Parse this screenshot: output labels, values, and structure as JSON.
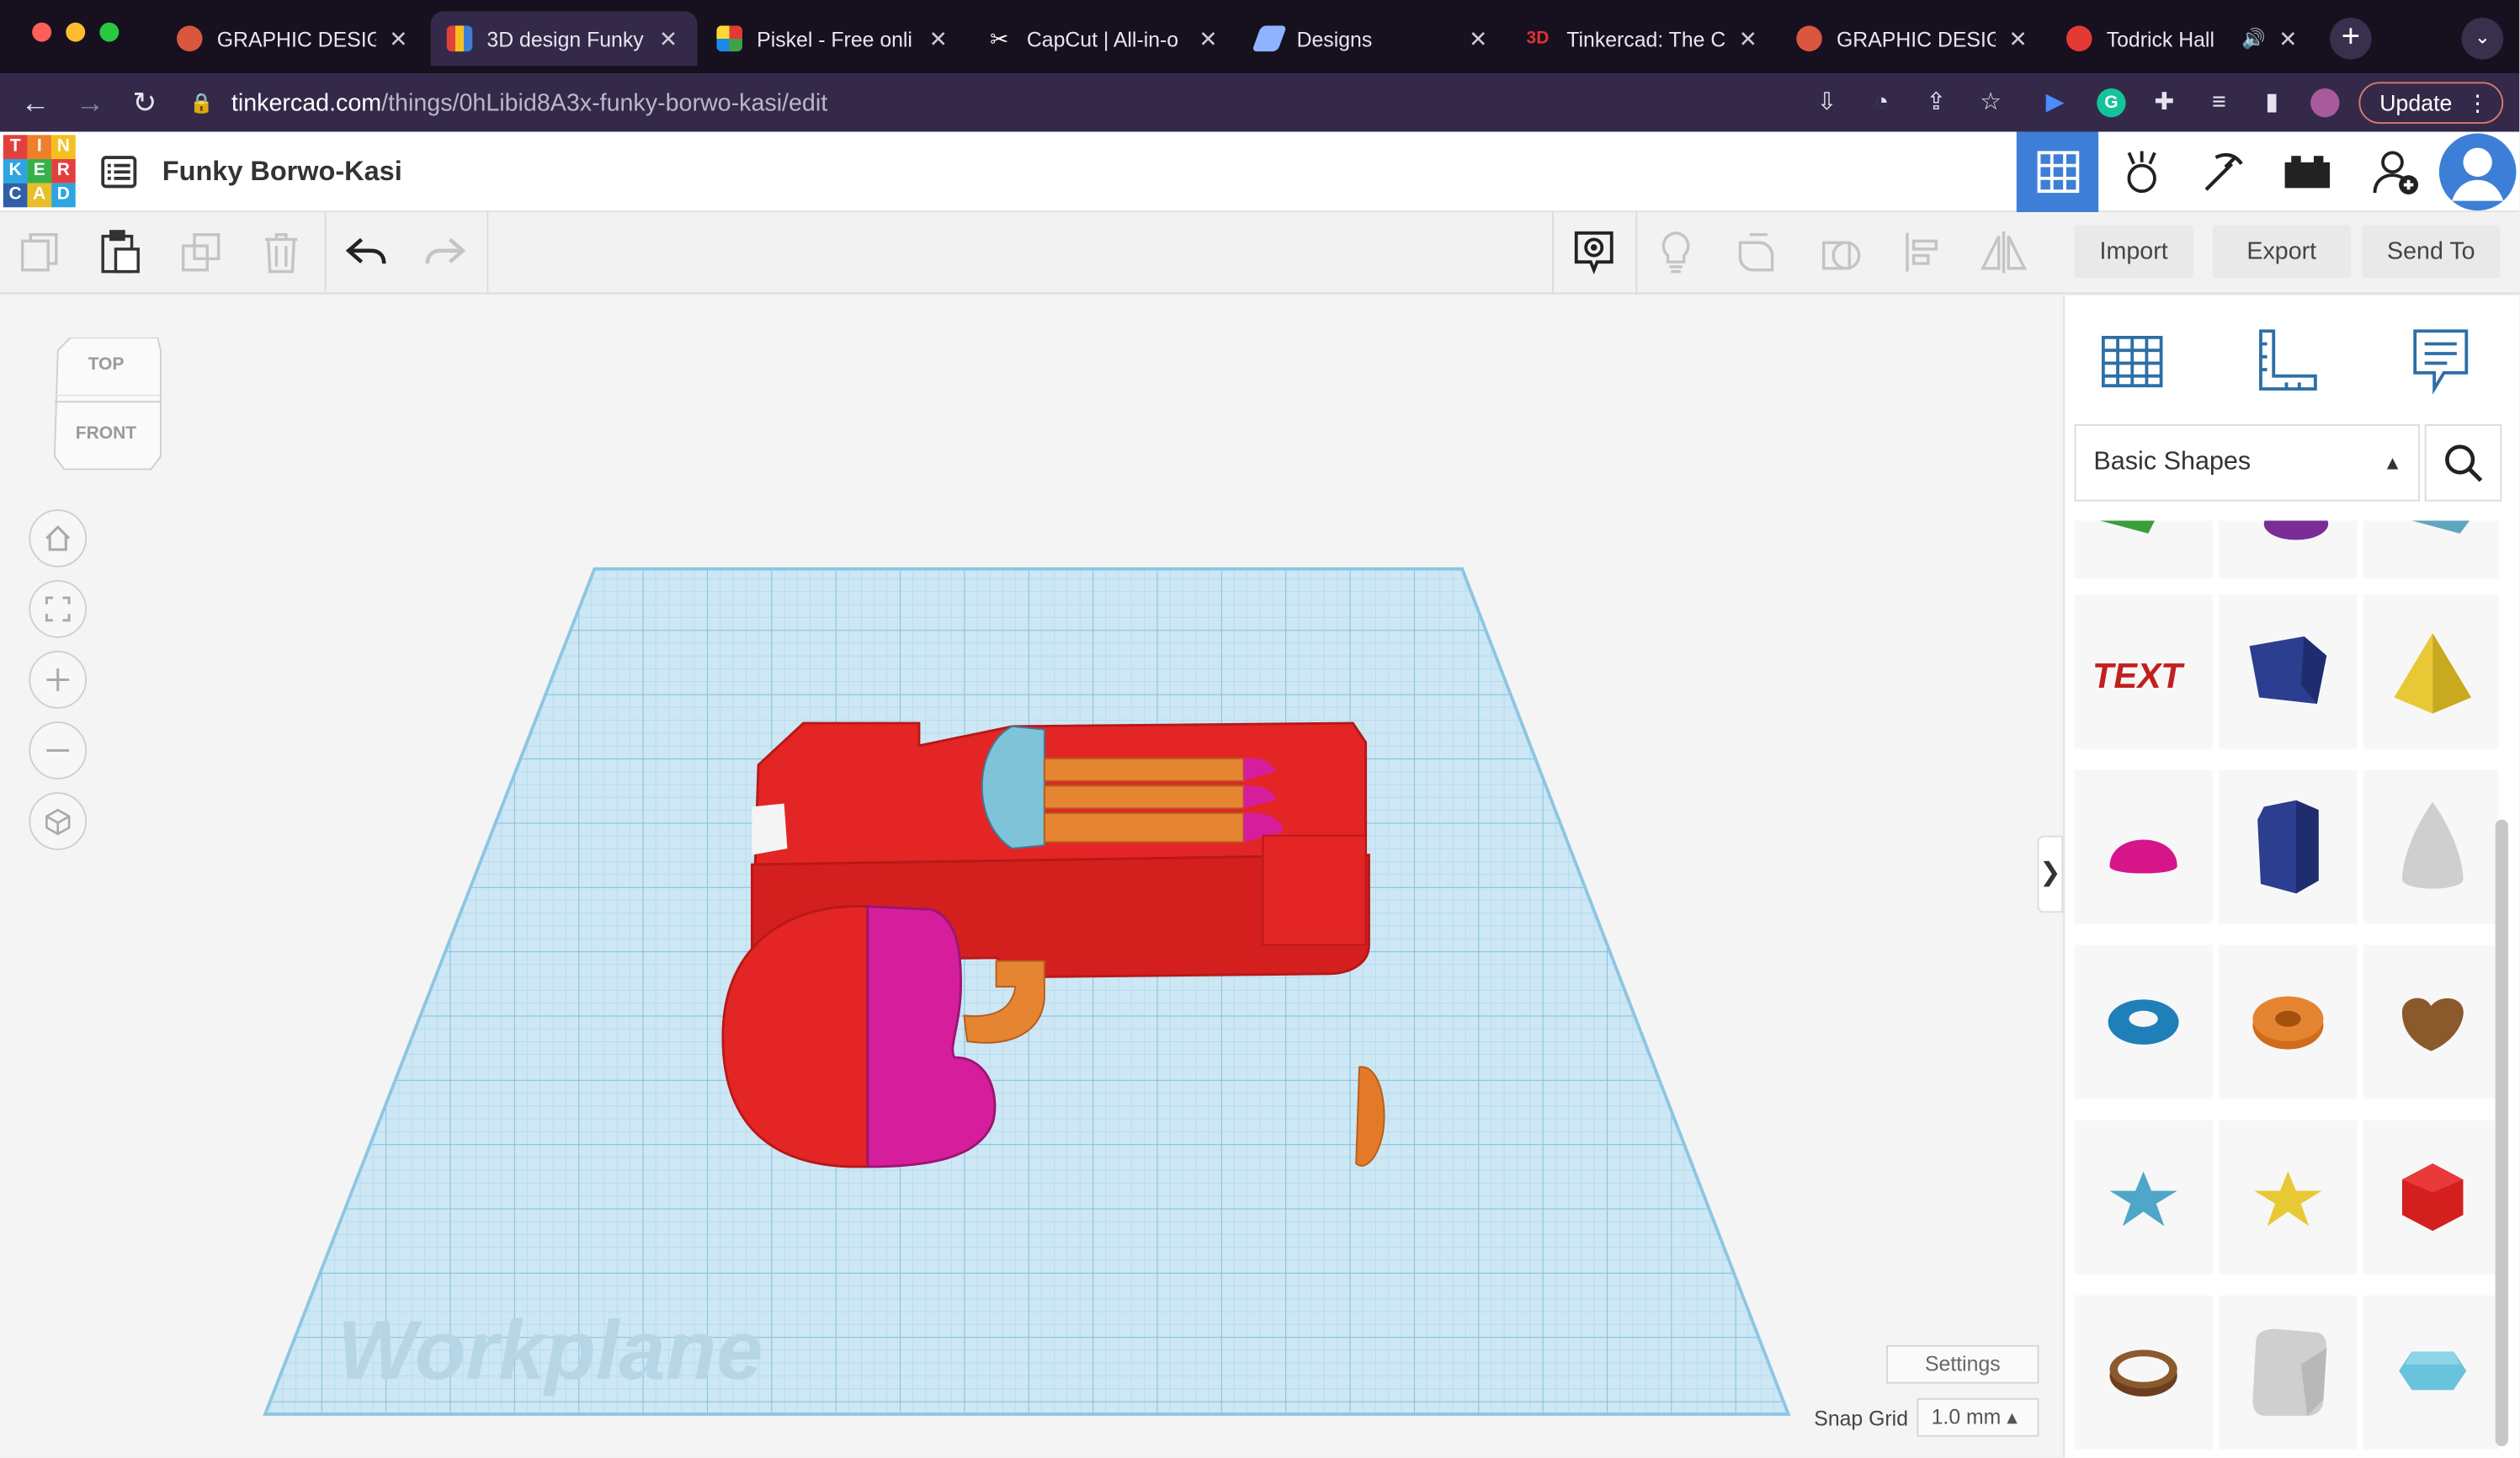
{
  "browser": {
    "tabs": [
      {
        "label": "GRAPHIC DESIGN",
        "favicon_color": "#d9573f"
      },
      {
        "label": "3D design Funky",
        "favicon_color": "#3d7fd7",
        "active": true
      },
      {
        "label": "Piskel - Free onli",
        "favicon_color": "#4caf50"
      },
      {
        "label": "CapCut | All-in-o",
        "favicon_color": "#ffffff"
      },
      {
        "label": "Designs",
        "favicon_color": "#8fb4ff"
      },
      {
        "label": "Tinkercad: The C",
        "favicon_color": "#d33"
      },
      {
        "label": "GRAPHIC DESIGN",
        "favicon_color": "#d9573f"
      },
      {
        "label": "Todrick Hall",
        "favicon_color": "#e53935"
      }
    ],
    "url_host": "tinkercad.com",
    "url_path": "/things/0hLibid8A3x-funky-borwo-kasi/edit",
    "update_label": "Update",
    "new_tab": "+",
    "tab_menu": "⌄"
  },
  "app": {
    "logo_letters": [
      "T",
      "I",
      "N",
      "K",
      "E",
      "R",
      "C",
      "A",
      "D"
    ],
    "logo_colors": [
      "#e2403d",
      "#f07e2a",
      "#f4c020",
      "#2ea5e0",
      "#37b04a",
      "#e2403d",
      "#2e5fa8",
      "#e8be2a",
      "#2ea5e0"
    ],
    "design_title": "Funky Borwo-Kasi"
  },
  "toolbar": {
    "import_label": "Import",
    "export_label": "Export",
    "send_to_label": "Send To"
  },
  "viewcube": {
    "top_label": "TOP",
    "front_label": "FRONT"
  },
  "workplane": {
    "label": "Workplane",
    "settings_label": "Settings",
    "snap_grid_label": "Snap Grid",
    "snap_grid_value": "1.0 mm ▴"
  },
  "panel": {
    "shape_category": "Basic Shapes",
    "collapse_glyph": "❯",
    "shapes": [
      "text-shape",
      "box-shape",
      "pyramid-shape",
      "half-sphere-shape",
      "hexagonal-prism-shape",
      "paraboloid-shape",
      "torus-shape",
      "tube-shape",
      "heart-shape",
      "star-shape",
      "star-shape-yellow",
      "icosahedron-shape",
      "ring-shape",
      "rounded-box-shape",
      "polygon-shape"
    ]
  }
}
